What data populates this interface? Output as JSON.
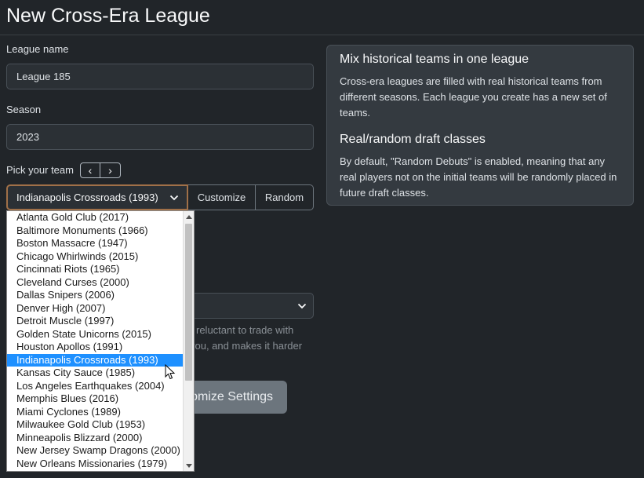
{
  "page": {
    "title": "New Cross-Era League"
  },
  "form": {
    "league_name_label": "League name",
    "league_name_value": "League 185",
    "season_label": "Season",
    "season_value": "2023",
    "pick_team_label": "Pick your team",
    "prev_icon": "‹",
    "next_icon": "›",
    "selected_team": "Indianapolis Crossroads (1993)",
    "customize_label": "Customize",
    "random_label": "Random",
    "partial_help_line1": "reluctant to trade with",
    "partial_help_line2": "you, and makes it harder",
    "customize_settings_partial": "omize Settings"
  },
  "info": {
    "heading1": "Mix historical teams in one league",
    "text1": "Cross-era leagues are filled with real historical teams from different seasons. Each league you create has a new set of teams.",
    "heading2": "Real/random draft classes",
    "text2": "By default, \"Random Debuts\" is enabled, meaning that any real players not on the initial teams will be randomly placed in future draft classes."
  },
  "dropdown": {
    "selected_index": 11,
    "options": [
      "Atlanta Gold Club (2017)",
      "Baltimore Monuments (1966)",
      "Boston Massacre (1947)",
      "Chicago Whirlwinds (2015)",
      "Cincinnati Riots (1965)",
      "Cleveland Curses (2000)",
      "Dallas Snipers (2006)",
      "Denver High (2007)",
      "Detroit Muscle (1997)",
      "Golden State Unicorns (2015)",
      "Houston Apollos (1991)",
      "Indianapolis Crossroads (1993)",
      "Kansas City Sauce (1985)",
      "Los Angeles Earthquakes (2004)",
      "Memphis Blues (2016)",
      "Miami Cyclones (1989)",
      "Milwaukee Gold Club (1953)",
      "Minneapolis Blizzard (2000)",
      "New Jersey Swamp Dragons (2000)",
      "New Orleans Missionaries (1979)"
    ]
  },
  "icons": {
    "chevron_down": "chevron-down-icon",
    "scroll_up": "scroll-up-arrow-icon",
    "scroll_down": "scroll-down-arrow-icon",
    "cursor": "mouse-pointer-icon"
  },
  "colors": {
    "background": "#212529",
    "panel": "#343a40",
    "selected_option": "#1e90ff",
    "select_focus_border": "#a07048"
  }
}
